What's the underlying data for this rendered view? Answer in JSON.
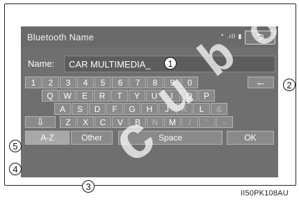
{
  "header": {
    "title": "Bluetooth Name",
    "status_indicators": "* .ıll ▮",
    "back_icon": "return-arrow-icon"
  },
  "name": {
    "label": "Name:",
    "value": "CAR MULTIMEDIA_"
  },
  "keyboard": {
    "row1": [
      "1",
      "2",
      "3",
      "4",
      "5",
      "6",
      "7",
      "8",
      "9",
      "0"
    ],
    "backspace": "←",
    "row2": [
      "Q",
      "W",
      "E",
      "R",
      "T",
      "Y",
      "U",
      "I",
      "O",
      "P"
    ],
    "row3": [
      "A",
      "S",
      "D",
      "F",
      "G",
      "H",
      "J",
      "K",
      "L",
      "&"
    ],
    "shift": "⇩",
    "row4": [
      "Z",
      "X",
      "C",
      "V",
      "B",
      "N",
      "M",
      "/",
      "'",
      "-"
    ],
    "bottom": {
      "az": "A-Z",
      "other": "Other",
      "space": "Space",
      "ok": "OK"
    }
  },
  "callouts": [
    "1",
    "2",
    "3",
    "4",
    "5"
  ],
  "figure_code": "II50PK108AU"
}
